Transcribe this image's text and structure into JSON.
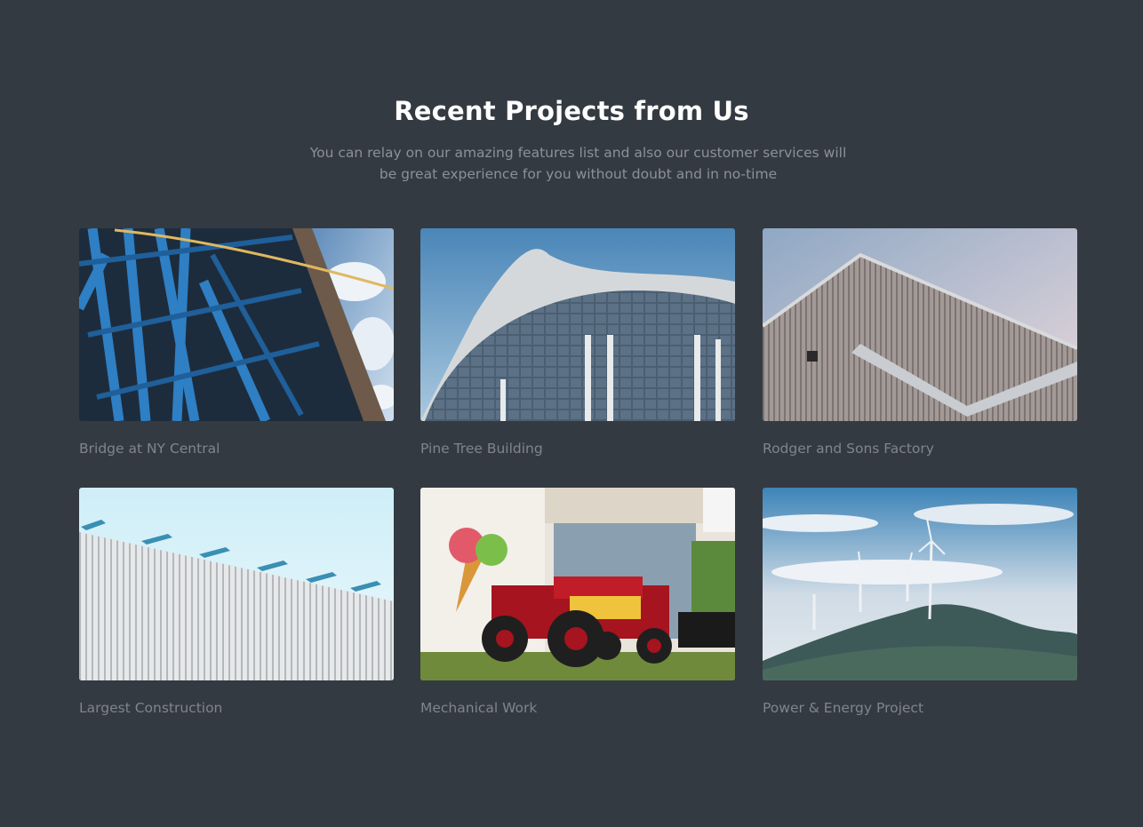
{
  "section": {
    "title": "Recent Projects from Us",
    "subtitle_line1": "You can relay on our amazing features list and also our customer services will",
    "subtitle_line2": "be great experience for you without doubt and in no-time"
  },
  "projects": [
    {
      "caption": "Bridge at NY Central",
      "image": "blue-steel-bridge-photo"
    },
    {
      "caption": "Pine Tree Building",
      "image": "curved-roof-building-photo"
    },
    {
      "caption": "Rodger and Sons Factory",
      "image": "corrugated-factory-roof-photo"
    },
    {
      "caption": "Largest Construction",
      "image": "white-cladding-solar-panels-photo"
    },
    {
      "caption": "Mechanical Work",
      "image": "red-vintage-tractor-gelato-photo"
    },
    {
      "caption": "Power & Energy Project",
      "image": "wind-turbines-hill-photo"
    }
  ],
  "colors": {
    "background": "#343a41",
    "title": "#ffffff",
    "text_muted": "#8b9198"
  }
}
